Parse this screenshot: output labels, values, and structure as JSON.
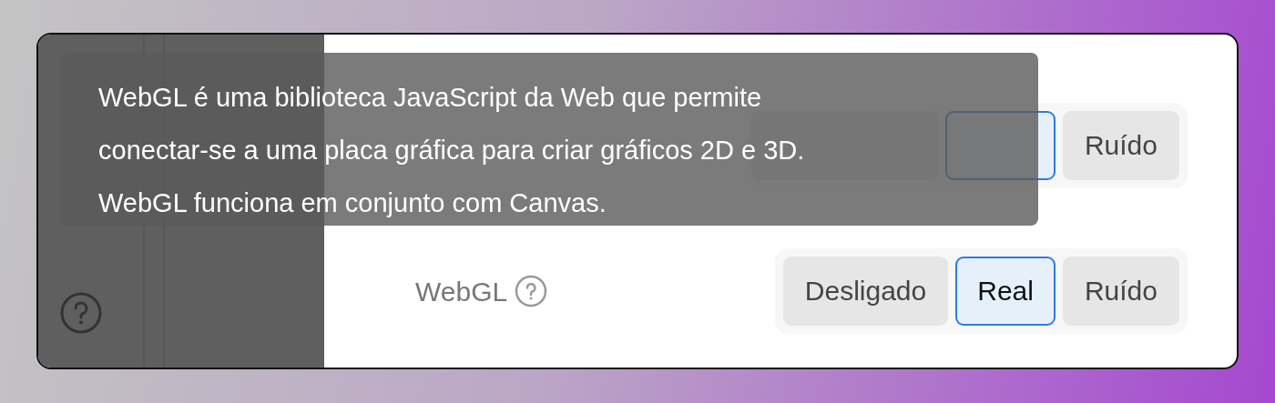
{
  "tooltip": {
    "lines": [
      "WebGL é uma biblioteca JavaScript da Web que permite",
      "conectar-se a uma placa gráfica para criar gráficos 2D e 3D.",
      "WebGL funciona em conjunto com Canvas."
    ]
  },
  "settings": [
    {
      "options": [
        {
          "selected": false
        },
        {
          "selected": true
        },
        {
          "label": "Ruído",
          "selected": false
        }
      ]
    },
    {
      "label": "WebGL",
      "options": [
        {
          "label": "Desligado",
          "selected": false
        },
        {
          "label": "Real",
          "selected": true
        },
        {
          "label": "Ruído",
          "selected": false
        }
      ]
    }
  ]
}
